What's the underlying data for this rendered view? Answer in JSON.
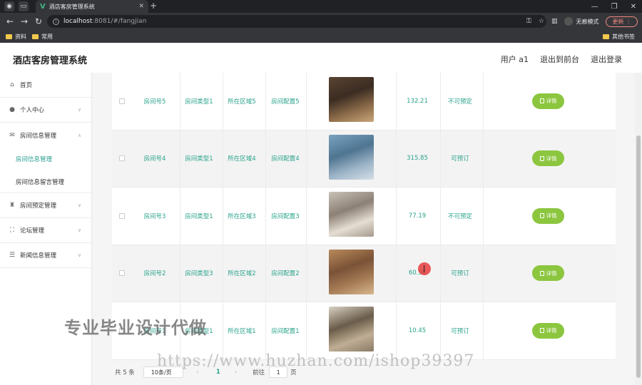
{
  "browser": {
    "tab_title": "酒店客房管理系统",
    "url_host": "localhost",
    "url_rest": ":8081/#/fangjian",
    "incognito_label": "无痕模式",
    "update_label": "更新",
    "bookmarks": [
      "资料",
      "常用"
    ],
    "bookmarks_right": "其他书签"
  },
  "header": {
    "title": "酒店客房管理系统",
    "user": "用户 a1",
    "front_link": "退出到前台",
    "logout_link": "退出登录"
  },
  "sidebar": {
    "home": "首页",
    "personal": "个人中心",
    "room_info": "房间信息管理",
    "room_info_sub": [
      "房间信息管理",
      "房间信息留言管理"
    ],
    "booking": "房间预定管理",
    "forum": "论坛管理",
    "news": "新闻信息管理"
  },
  "rows": [
    {
      "room_no": "房间号5",
      "type": "房间类型1",
      "area": "所在区域5",
      "config": "房间配置5",
      "price": "132.21",
      "status": "不可预定",
      "action": "详情"
    },
    {
      "room_no": "房间号4",
      "type": "房间类型1",
      "area": "所在区域4",
      "config": "房间配置4",
      "price": "315.85",
      "status": "可预订",
      "action": "详情"
    },
    {
      "room_no": "房间号3",
      "type": "房间类型1",
      "area": "所在区域3",
      "config": "房间配置3",
      "price": "77.19",
      "status": "不可预定",
      "action": "详情"
    },
    {
      "room_no": "房间号2",
      "type": "房间类型3",
      "area": "所在区域2",
      "config": "房间配置2",
      "price": "60.98",
      "status": "可预订",
      "action": "详情"
    },
    {
      "room_no": "房间号1",
      "type": "房间类型1",
      "area": "所在区域1",
      "config": "房间配置1",
      "price": "10.45",
      "status": "可预订",
      "action": "详情"
    }
  ],
  "pager": {
    "total": "共 5 条",
    "page_size": "10条/页",
    "current": "1",
    "goto": "前往",
    "goto_value": "1",
    "unit": "页"
  },
  "watermarks": {
    "cn": "专业毕业设计代做",
    "url": "https://www.huzhan.com/ishop39397"
  },
  "colors": {
    "accent": "#2aa38c",
    "button": "#8cc63f"
  }
}
